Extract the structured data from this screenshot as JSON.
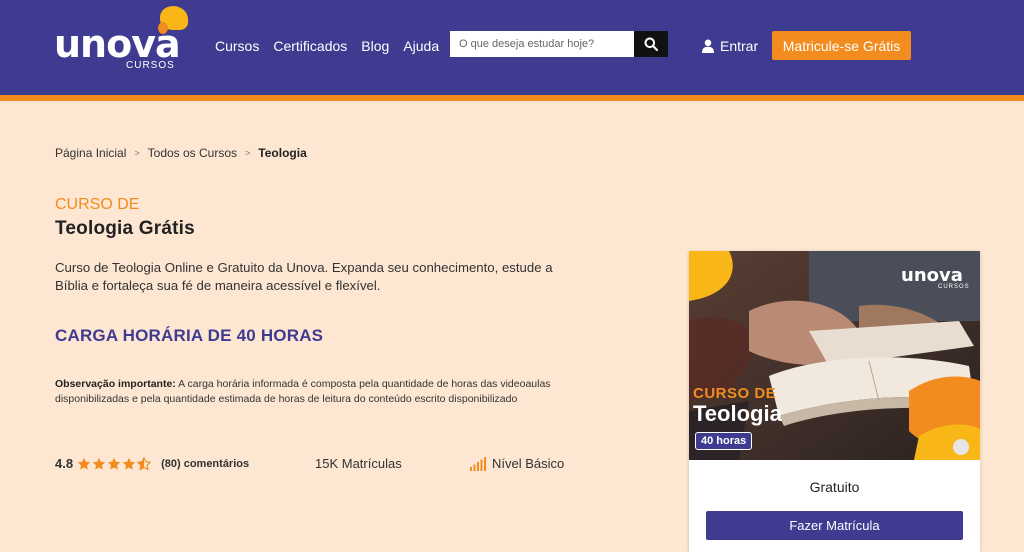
{
  "brand": {
    "name": "unova",
    "sub": "CURSOS",
    "primary_color": "#3f3b90",
    "accent_color": "#f28c1e"
  },
  "nav": {
    "items": [
      "Cursos",
      "Certificados",
      "Blog",
      "Ajuda"
    ]
  },
  "search": {
    "placeholder": "O que deseja estudar hoje?",
    "icon": "search-icon"
  },
  "header": {
    "login_label": "Entrar",
    "cta_label": "Matricule-se Grátis"
  },
  "breadcrumb": {
    "items": [
      "Página Inicial",
      "Todos os Cursos",
      "Teologia"
    ],
    "separator": ">"
  },
  "course": {
    "pre_title": "CURSO DE",
    "title": "Teologia Grátis",
    "description": "Curso de Teologia Online e Gratuito da Unova. Expanda seu conhecimento, estude a Bíblia e fortaleça sua fé de maneira acessível e flexível.",
    "workload": "CARGA HORÁRIA DE 40 HORAS",
    "obs_label": "Observação importante:",
    "obs_text": "A carga horária informada é composta pela quantidade de horas das videoaulas disponibilizadas e pela quantidade estimada de horas de leitura do conteúdo escrito disponibilizado"
  },
  "stats": {
    "rating": "4.8",
    "stars": 4.5,
    "comments": "(80) comentários",
    "enrollments": "15K Matrículas",
    "level": "Nível Básico"
  },
  "card": {
    "image_pre": "CURSO DE",
    "image_title": "Teologia",
    "image_badge": "40 horas",
    "image_logo": "unova",
    "image_logo_sub": "CURSOS",
    "price": "Gratuito",
    "button_label": "Fazer Matrícula"
  }
}
